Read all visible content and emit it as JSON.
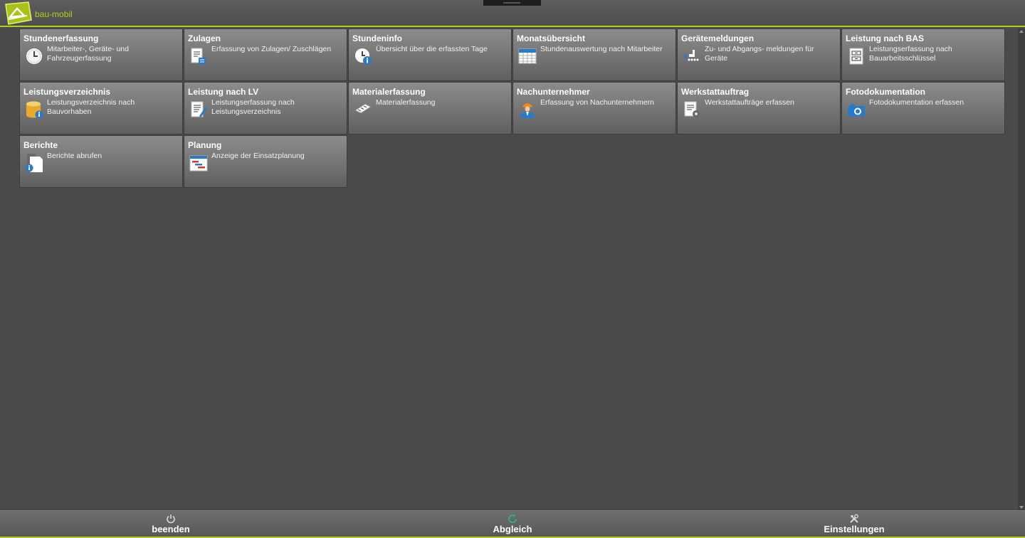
{
  "app": {
    "title": "bau-mobil"
  },
  "tiles": [
    {
      "title": "Stundenerfassung",
      "desc": "Mitarbeiter-, Geräte- und Fahrzeugerfassung",
      "icon": "clock-icon"
    },
    {
      "title": "Zulagen",
      "desc": "Erfassung von Zulagen/ Zuschlägen",
      "icon": "document-calculator-icon"
    },
    {
      "title": "Stundeninfo",
      "desc": "Übersicht über die erfassten Tage",
      "icon": "clock-info-icon"
    },
    {
      "title": "Monatsübersicht",
      "desc": "Stundenauswertung nach Mitarbeiter",
      "icon": "calendar-grid-icon"
    },
    {
      "title": "Gerätemeldungen",
      "desc": "Zu- und Abgangs- meldungen für Geräte",
      "icon": "equipment-arrow-icon"
    },
    {
      "title": "Leistung nach BAS",
      "desc": "Leistungserfassung nach Bauarbeitsschlüssel",
      "icon": "cabinet-icon"
    },
    {
      "title": "Leistungsverzeichnis",
      "desc": "Leistungsverzeichnis nach Bauvorhaben",
      "icon": "database-info-icon"
    },
    {
      "title": "Leistung nach LV",
      "desc": "Leistungserfassung nach Leistungsverzeichnis",
      "icon": "document-edit-icon"
    },
    {
      "title": "Materialerfassung",
      "desc": "Materialerfassung",
      "icon": "material-plank-icon"
    },
    {
      "title": "Nachunternehmer",
      "desc": "Erfassung von Nachunternehmern",
      "icon": "worker-icon"
    },
    {
      "title": "Werkstattauftrag",
      "desc": "Werkstattaufträge erfassen",
      "icon": "document-gear-icon"
    },
    {
      "title": "Fotodokumentation",
      "desc": "Fotodokumentation erfassen",
      "icon": "camera-icon"
    },
    {
      "title": "Berichte",
      "desc": "Berichte abrufen",
      "icon": "report-info-icon"
    },
    {
      "title": "Planung",
      "desc": "Anzeige der Einsatzplanung",
      "icon": "gantt-chart-icon"
    }
  ],
  "footer": {
    "quit_label": "beenden",
    "sync_label": "Abgleich",
    "settings_label": "Einstellungen"
  },
  "colors": {
    "accent": "#b5cc18",
    "background": "#4a4a4a",
    "tile": "#7a7a7a"
  }
}
